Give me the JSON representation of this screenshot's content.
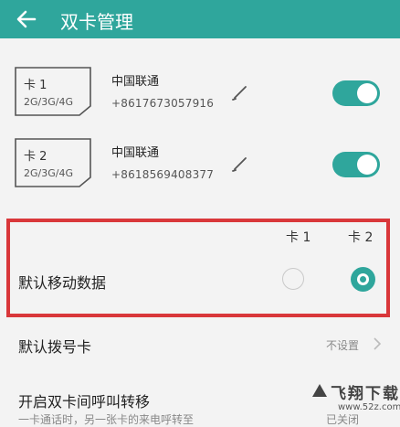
{
  "header": {
    "title": "双卡管理"
  },
  "sims": [
    {
      "slot": "卡 1",
      "networks": "2G/3G/4G",
      "carrier": "中国联通",
      "number": "+8617673057916",
      "enabled": true
    },
    {
      "slot": "卡 2",
      "networks": "2G/3G/4G",
      "carrier": "中国联通",
      "number": "+8618569408377",
      "enabled": true
    }
  ],
  "data_selection": {
    "columns": [
      "卡 1",
      "卡 2"
    ],
    "label": "默认移动数据",
    "selected": "卡 2"
  },
  "default_dial": {
    "label": "默认拨号卡",
    "value": "不设置"
  },
  "call_forward": {
    "label": "开启双卡间呼叫转移",
    "sub": "一卡通话时，另一张卡的来电呼转至",
    "value": "已关闭"
  },
  "watermark": {
    "text": "飞翔下载",
    "url": "www.52z.com"
  },
  "colors": {
    "accent": "#2fa69c",
    "highlight": "#d9373a",
    "background": "#f3f3f3"
  }
}
